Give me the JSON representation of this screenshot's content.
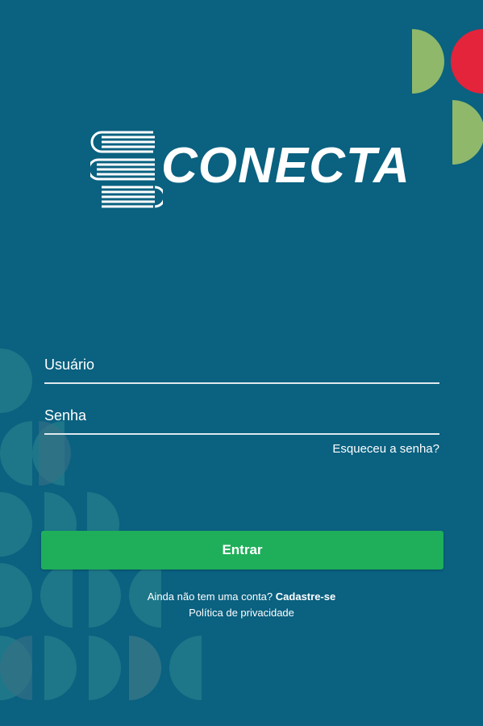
{
  "brand": {
    "name": "CONECTA",
    "logo_icon": "books-stack-icon"
  },
  "login_form": {
    "username_placeholder": "Usuário",
    "password_placeholder": "Senha",
    "forgot_password_link": "Esqueceu a senha?",
    "submit_label": "Entrar"
  },
  "footer": {
    "signup_prompt": "Ainda não tem uma conta?",
    "signup_link": "Cadastre-se",
    "privacy_link": "Política de privacidade"
  },
  "colors": {
    "background": "#0a6180",
    "primary_button": "#1faf5a",
    "accent_green": "#8fb86a",
    "accent_red": "#e3243b"
  }
}
